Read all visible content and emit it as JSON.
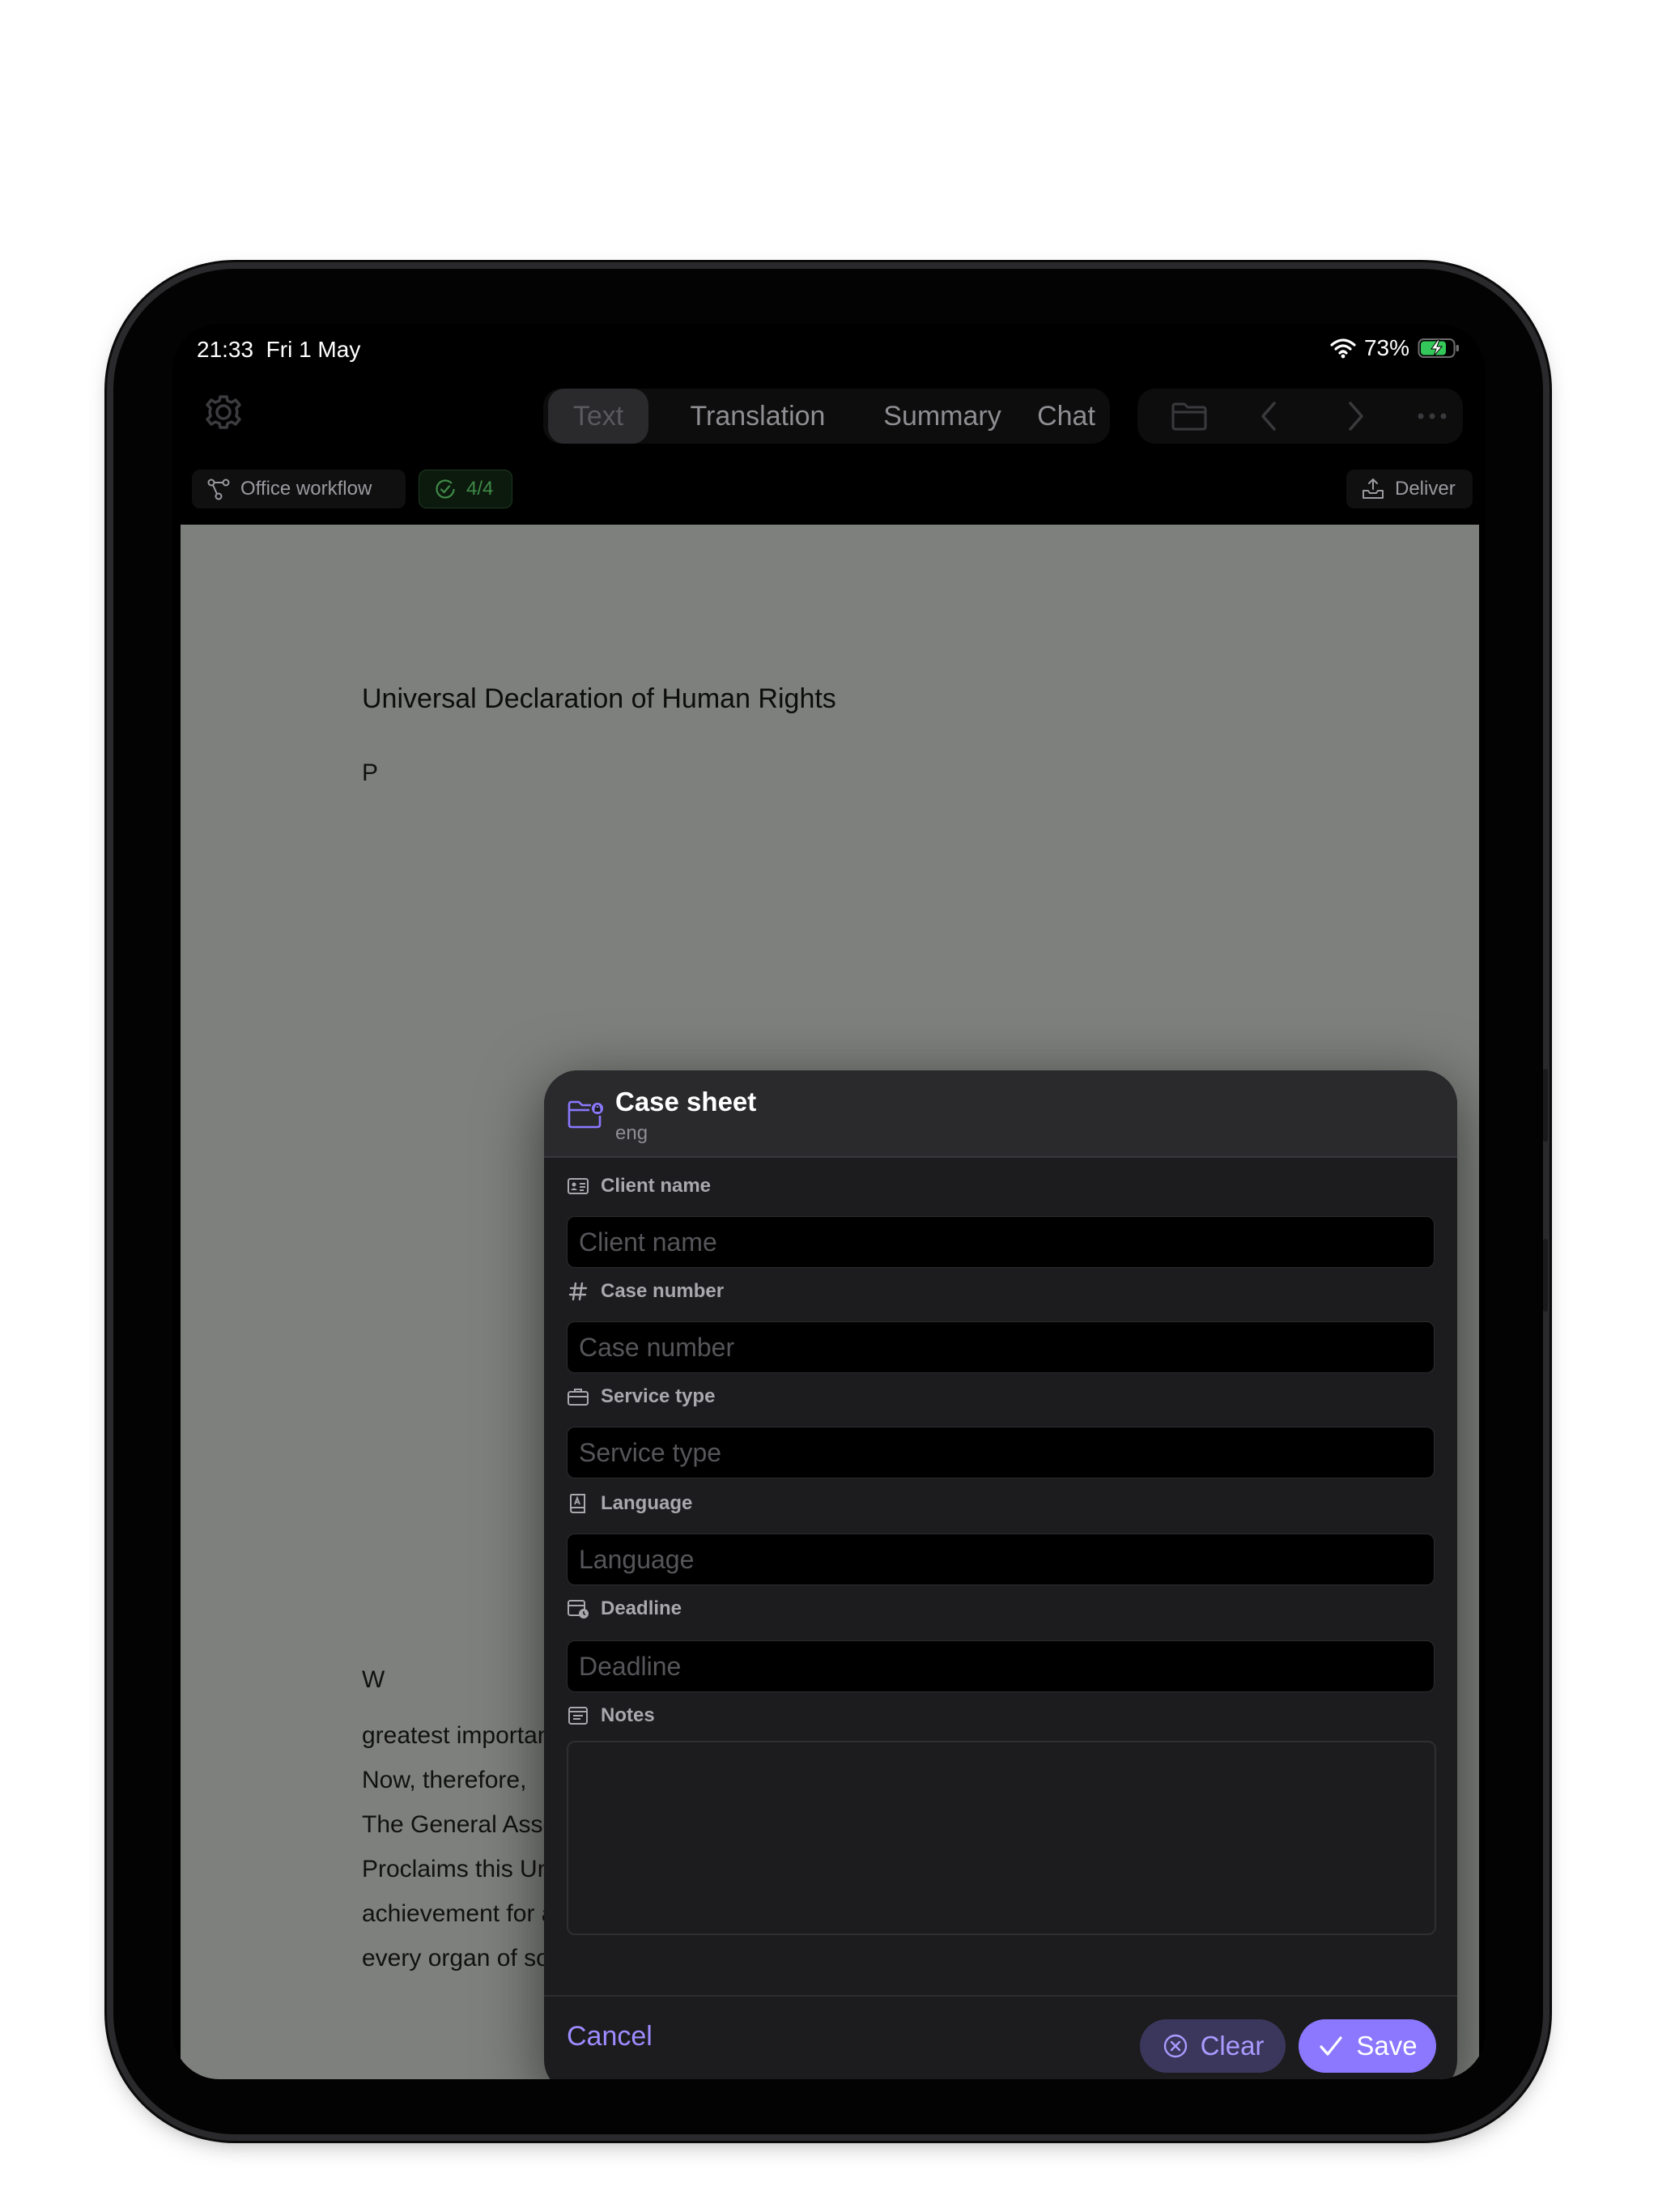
{
  "status_bar": {
    "time": "21:33",
    "date": "Fri 1 May",
    "battery": "73%"
  },
  "toolbar": {
    "tabs": [
      {
        "label": "Text",
        "active": true
      },
      {
        "label": "Translation",
        "active": false
      },
      {
        "label": "Summary",
        "active": false
      },
      {
        "label": "Chat",
        "active": false
      }
    ]
  },
  "subbar": {
    "workflow_label": "Office workflow",
    "progress_badge": "4/4",
    "deliver_label": "Deliver"
  },
  "document": {
    "title": "Universal Declaration of Human Rights",
    "fragments": [
      "P",
      "W"
    ],
    "lines": [
      "greatest importance for the full realization of this pledge,",
      "Now, therefore,",
      "The General Assembly,",
      "Proclaims this Universal Declaration of Human Rights as a common standard of",
      "achievement for all peoples and all nations, to the end that every individual and",
      "every organ of society, keeping this Declaration constantly in mind, shall strive by"
    ]
  },
  "modal": {
    "title": "Case sheet",
    "subtitle": "eng",
    "fields": {
      "client_name": {
        "label": "Client name",
        "placeholder": "Client name",
        "value": ""
      },
      "case_number": {
        "label": "Case number",
        "placeholder": "Case number",
        "value": ""
      },
      "service_type": {
        "label": "Service type",
        "placeholder": "Service type",
        "value": ""
      },
      "language": {
        "label": "Language",
        "placeholder": "Language",
        "value": ""
      },
      "deadline": {
        "label": "Deadline",
        "placeholder": "Deadline",
        "value": ""
      },
      "notes": {
        "label": "Notes",
        "value": ""
      }
    },
    "cancel_label": "Cancel",
    "clear_label": "Clear",
    "save_label": "Save"
  },
  "colors": {
    "accent": "#8b78ff",
    "accent_text": "#9d8cff",
    "clear_bg": "#3b365c",
    "badge_green": "#3f8a47",
    "document_bg": "#7e807d"
  },
  "icons": {
    "settings": "gear-icon",
    "folder": "folder-icon",
    "back": "chevron-left-icon",
    "forward": "chevron-right-icon",
    "more": "ellipsis-icon",
    "workflow": "workflow-icon",
    "check": "check-circle-icon",
    "deliver": "tray-upload-icon",
    "case_sheet": "folder-badge-icon"
  }
}
